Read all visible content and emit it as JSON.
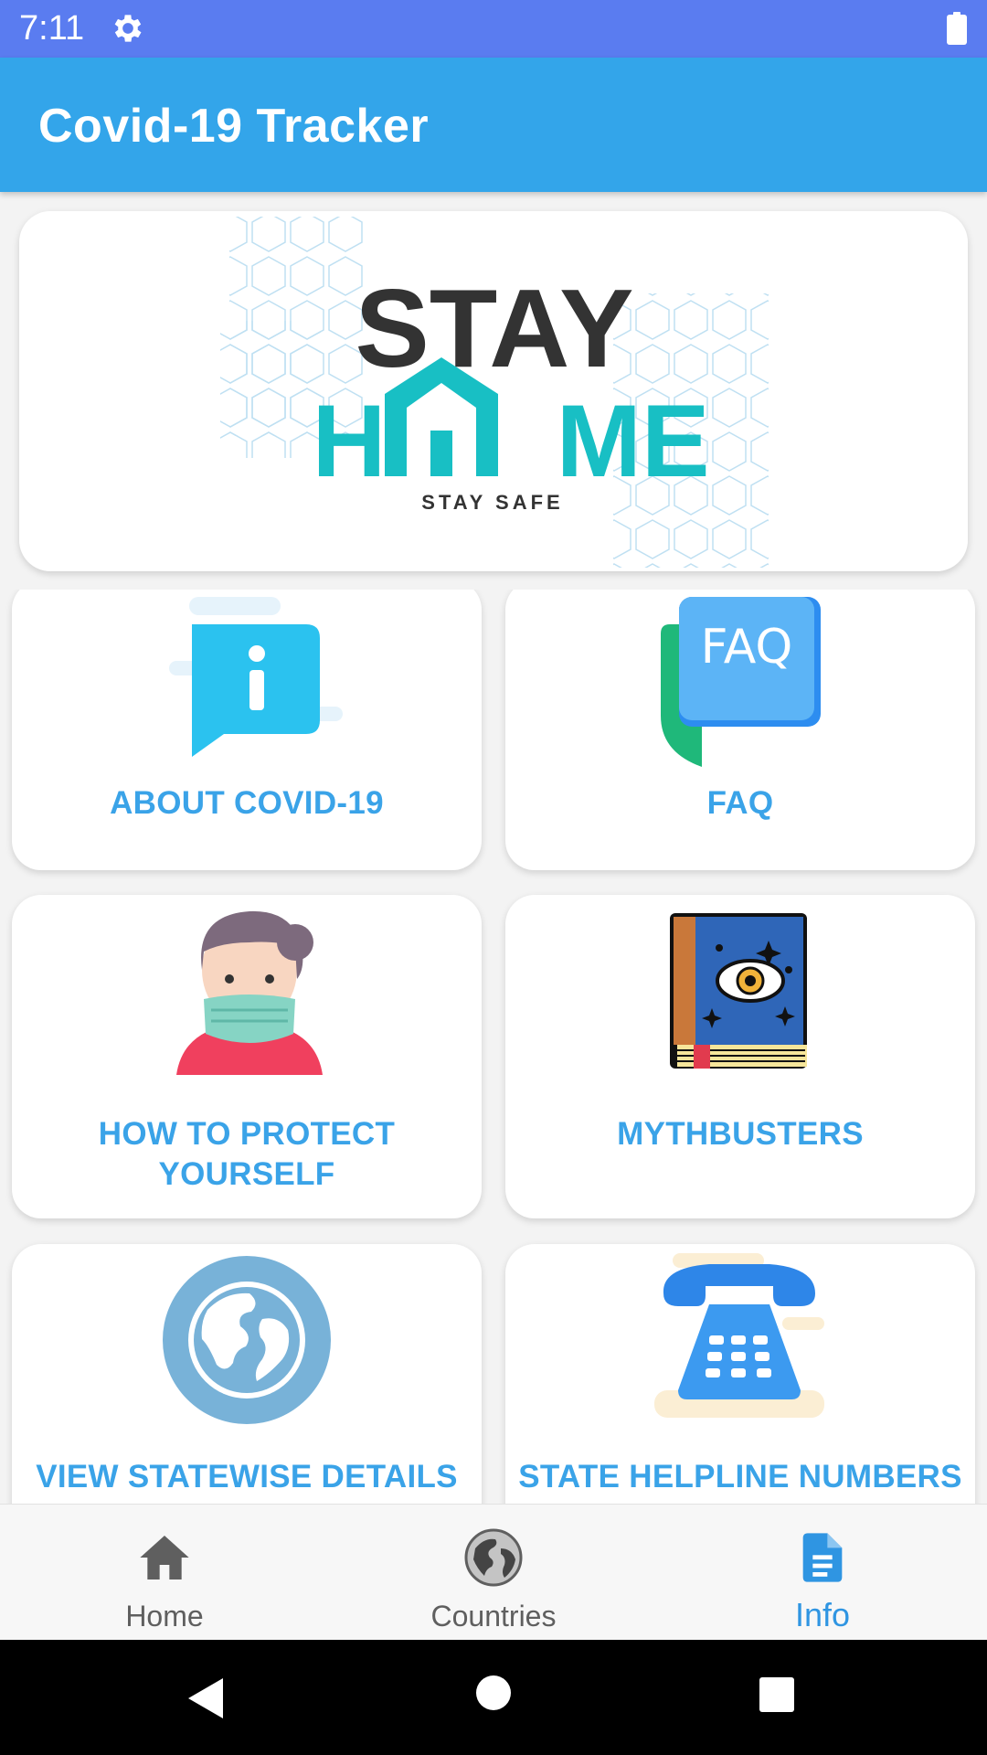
{
  "status_bar": {
    "time": "7:11",
    "icons": [
      "gear-icon",
      "battery-icon"
    ]
  },
  "app_bar": {
    "title": "Covid-19 Tracker"
  },
  "banner": {
    "line1": "STAY",
    "line2_prefix": "H",
    "line2_suffix": "ME",
    "line3": "STAY SAFE"
  },
  "tiles": [
    {
      "label": "ABOUT COVID-19",
      "icon": "info-chat-icon"
    },
    {
      "label": "FAQ",
      "icon": "faq-chat-icon",
      "icon_text": "FAQ"
    },
    {
      "label_line1": "HOW TO PROTECT",
      "label_line2": "YOURSELF",
      "icon": "masked-person-icon"
    },
    {
      "label": "MYTHBUSTERS",
      "icon": "mystery-book-icon"
    },
    {
      "label": "VIEW STATEWISE DETAILS",
      "icon": "globe-icon"
    },
    {
      "label": "STATE HELPLINE NUMBERS",
      "icon": "telephone-icon"
    }
  ],
  "bottom_nav": {
    "items": [
      {
        "label": "Home",
        "icon": "home-icon",
        "active": false
      },
      {
        "label": "Countries",
        "icon": "globe-icon",
        "active": false
      },
      {
        "label": "Info",
        "icon": "document-icon",
        "active": true
      }
    ]
  },
  "system_nav": {
    "icons": [
      "back-icon",
      "home-circle-icon",
      "recents-icon"
    ]
  },
  "colors": {
    "status_bar": "#5a7cf0",
    "app_bar": "#33a5ea",
    "accent_label": "#3aa3e8",
    "active_nav": "#2f95e2",
    "inactive_nav": "#5f5f5f"
  }
}
